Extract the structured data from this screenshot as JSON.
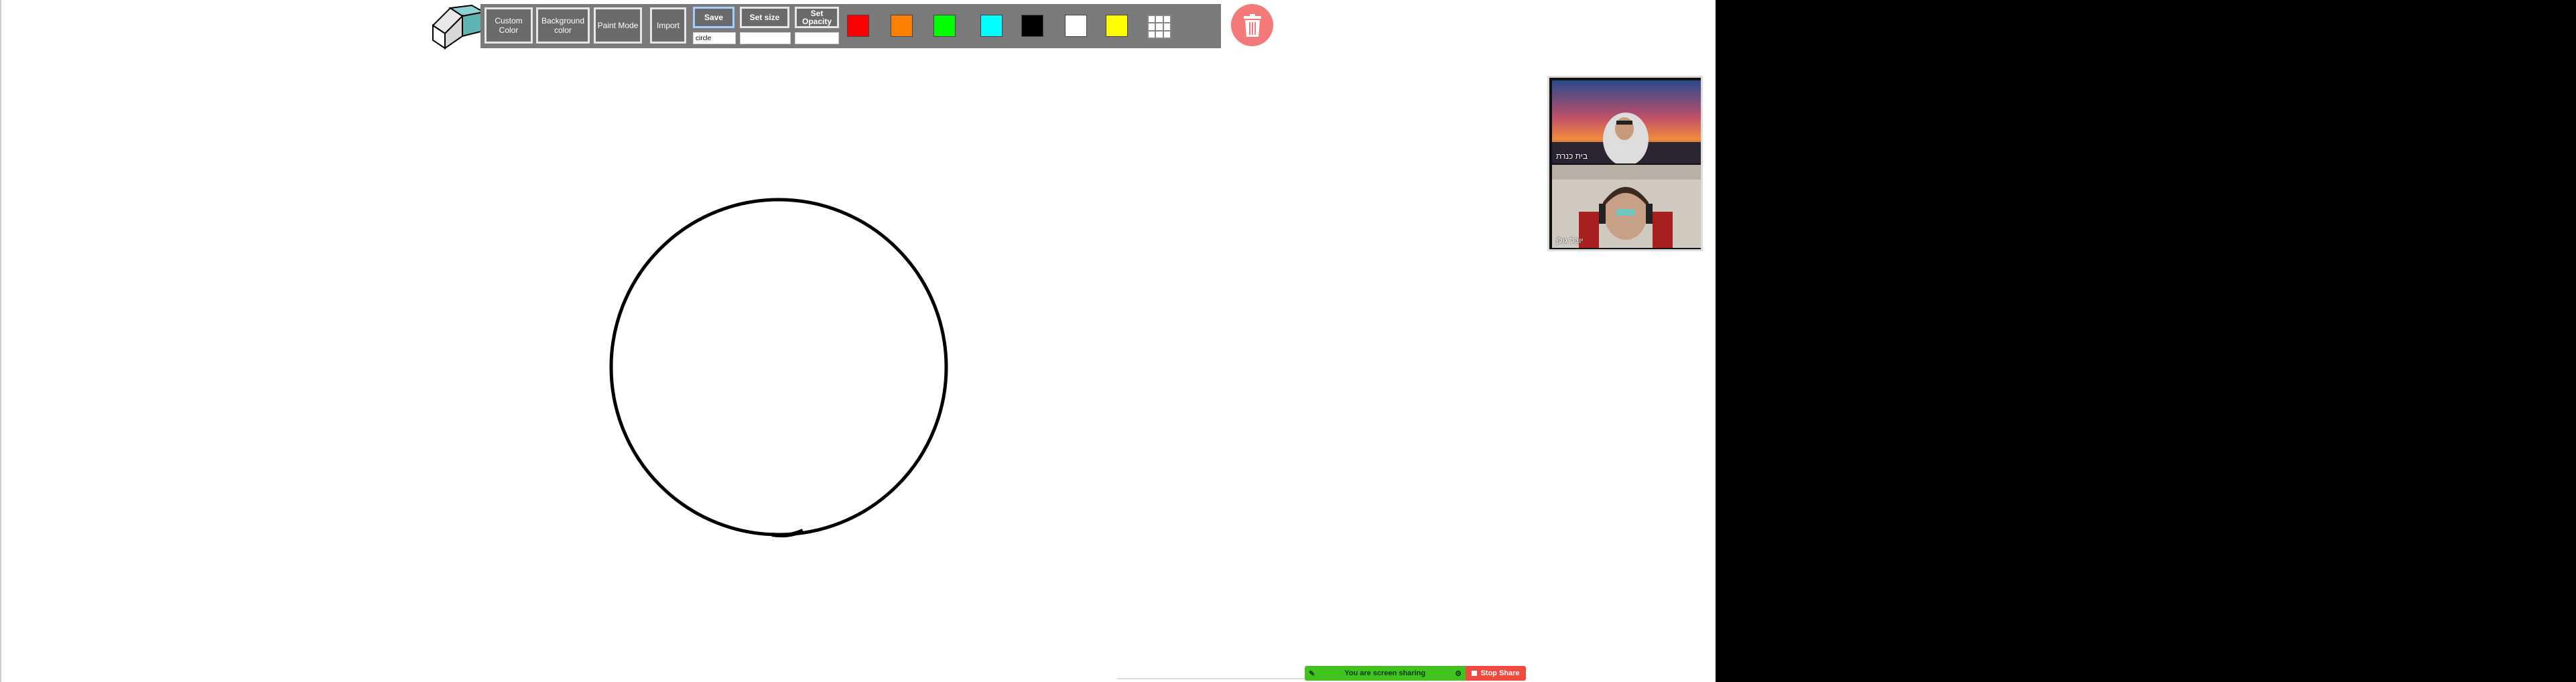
{
  "toolbar": {
    "custom_color": "Custom Color",
    "background_color": "Background color",
    "paint_mode": "Paint Mode",
    "import": "Import",
    "save": "Save",
    "set_size": "Set size",
    "set_opacity": "Set Opacity",
    "save_input_value": "circle",
    "size_input_value": "",
    "opacity_input_value": ""
  },
  "palette": [
    {
      "name": "red",
      "color": "#ff0000"
    },
    {
      "name": "orange",
      "color": "#ff7f00"
    },
    {
      "name": "green",
      "color": "#00ff00"
    },
    {
      "name": "cyan",
      "color": "#00ffff"
    },
    {
      "name": "black",
      "color": "#000000"
    },
    {
      "name": "white",
      "color": "#ffffff"
    },
    {
      "name": "yellow",
      "color": "#ffff00"
    }
  ],
  "icons": {
    "eraser": "eraser-icon",
    "grid": "grid-icon",
    "trash": "trash-icon",
    "pin": "pin-icon",
    "stop": "stop-icon"
  },
  "video": {
    "participant_1": "בית כנרת",
    "participant_2": "יובל גולן"
  },
  "sharing": {
    "status": "You are screen sharing",
    "stop_label": "Stop Share"
  },
  "colors": {
    "toolbar_bg": "#7a7a7a",
    "trash_bg": "#f47a7a",
    "share_green": "#41c21f",
    "stop_red": "#f0493f"
  }
}
